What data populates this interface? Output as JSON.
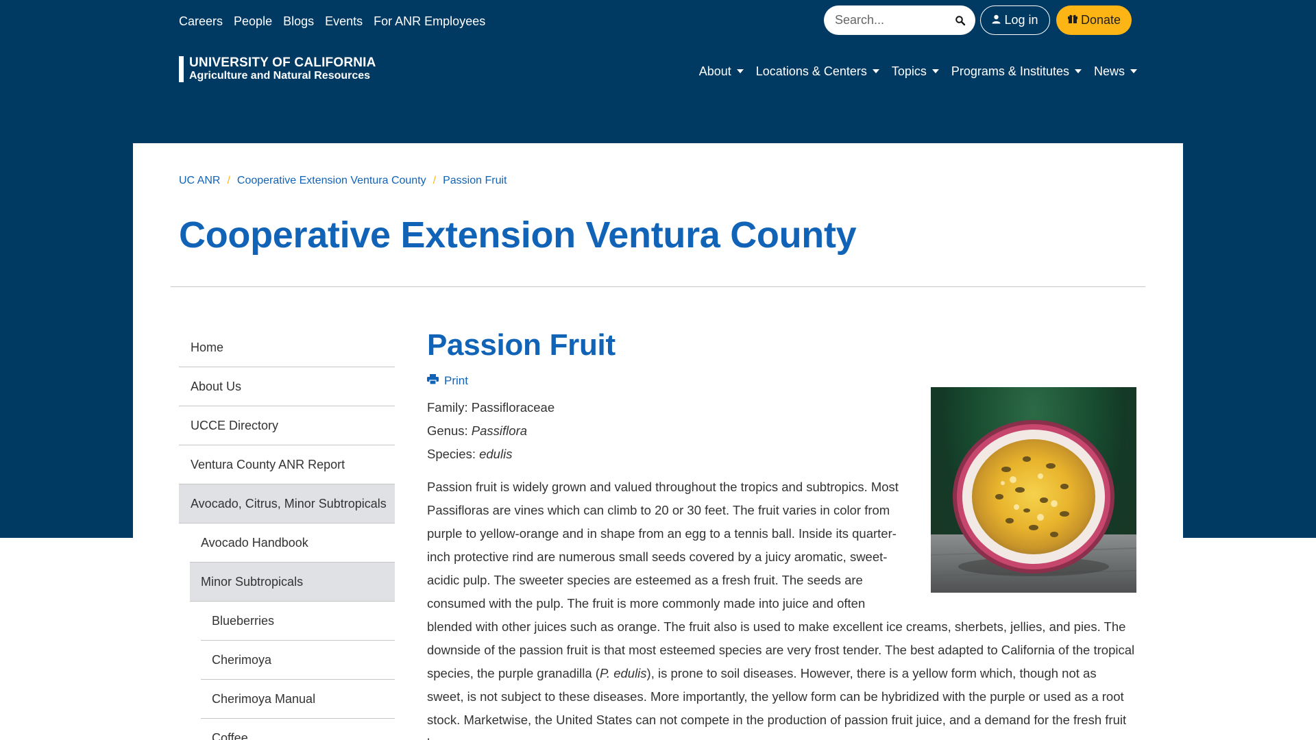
{
  "utility_nav": [
    "Careers",
    "People",
    "Blogs",
    "Events",
    "For ANR Employees"
  ],
  "search": {
    "placeholder": "Search..."
  },
  "login_label": "Log in",
  "donate_label": "Donate",
  "logo": {
    "line1": "UNIVERSITY OF CALIFORNIA",
    "line2": "Agriculture and Natural Resources"
  },
  "main_nav": [
    "About",
    "Locations & Centers",
    "Topics",
    "Programs & Institutes",
    "News"
  ],
  "breadcrumb": [
    "UC ANR",
    "Cooperative Extension Ventura County",
    "Passion Fruit"
  ],
  "page_title": "Cooperative Extension Ventura County",
  "sidenav": [
    {
      "label": "Home",
      "level": 0,
      "active": false
    },
    {
      "label": "About Us",
      "level": 0,
      "active": false
    },
    {
      "label": "UCCE Directory",
      "level": 0,
      "active": false
    },
    {
      "label": "Ventura County ANR Report",
      "level": 0,
      "active": false
    },
    {
      "label": "Avocado, Citrus, Minor Subtropicals",
      "level": 0,
      "active": true
    },
    {
      "label": "Avocado Handbook",
      "level": 1,
      "active": false
    },
    {
      "label": "Minor Subtropicals",
      "level": 1,
      "active": true
    },
    {
      "label": "Blueberries",
      "level": 2,
      "active": false
    },
    {
      "label": "Cherimoya",
      "level": 2,
      "active": false
    },
    {
      "label": "Cherimoya Manual",
      "level": 2,
      "active": false
    },
    {
      "label": "Coffee",
      "level": 2,
      "active": false
    }
  ],
  "article": {
    "title": "Passion Fruit",
    "print_label": "Print",
    "family_label": "Family:",
    "family": "Passifloraceae",
    "genus_label": "Genus:",
    "genus": "Passiflora",
    "species_label": "Species:",
    "species": "edulis",
    "body_part1": "Passion fruit is widely grown and valued throughout the tropics and subtropics. Most Passifloras are vines which can climb to 20 or 30 feet. The fruit varies in color from purple to yellow-orange and in shape from an egg to a tennis ball. Inside its quarter-inch protective rind are numerous small seeds covered by a juicy aromatic, sweet-acidic pulp. The sweeter species are esteemed as a fresh fruit. The seeds are consumed with the pulp. The fruit is more commonly made into juice and often blended with other juices such as orange. The fruit also is used to make excellent ice creams, sherbets, jellies, and pies. The downside of the passion fruit is that most esteemed species are very frost tender. The best adapted to California of the tropical species, the purple granadilla (",
    "body_italic": "P. edulis",
    "body_part2": "), is prone to soil diseases. However, there is a yellow form which, though not as sweet, is not subject to these diseases. More importantly, the yellow form can be hybridized with the purple or used as a root stock. Marketwise, the United States can not compete in the production of passion fruit juice, and a demand for the fresh fruit has"
  },
  "colors": {
    "header_blue": "#003a63",
    "link_blue": "#1063b6",
    "donate_gold": "#fdb515"
  }
}
